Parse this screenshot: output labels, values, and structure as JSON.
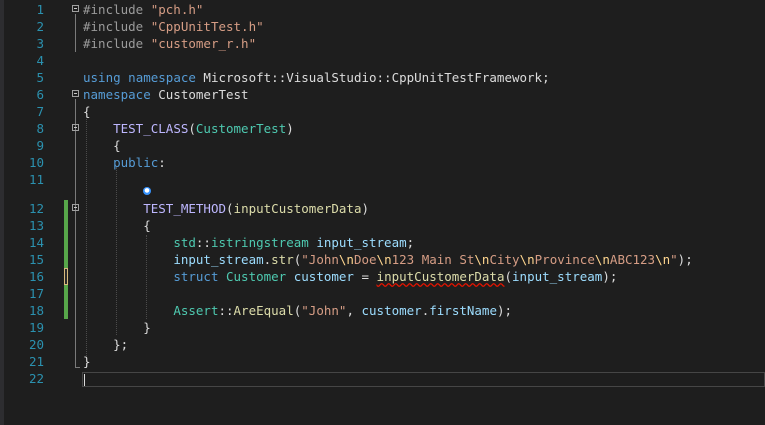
{
  "editor": {
    "language": "C++",
    "hint_icon": "info-icon",
    "colors": {
      "background": "#1e1e1e",
      "line_number": "#2b91af",
      "keyword": "#569cd6",
      "string": "#d69d85",
      "type": "#4ec9b0",
      "function": "#dcdcaa",
      "variable": "#9cdcfe",
      "macro": "#beb7ff",
      "change_marker": "#57a64a",
      "error_squiggle": "#e51400"
    },
    "lines": [
      {
        "n": "1",
        "t": [
          [
            "pp",
            "#include "
          ],
          [
            "str",
            "\"pch.h\""
          ]
        ]
      },
      {
        "n": "2",
        "t": [
          [
            "pp",
            "#include "
          ],
          [
            "str",
            "\"CppUnitTest.h\""
          ]
        ]
      },
      {
        "n": "3",
        "t": [
          [
            "pp",
            "#include "
          ],
          [
            "str",
            "\"customer_r.h\""
          ]
        ]
      },
      {
        "n": "4",
        "t": []
      },
      {
        "n": "5",
        "t": [
          [
            "kw",
            "using"
          ],
          [
            "",
            " "
          ],
          [
            "kw",
            "namespace"
          ],
          [
            "",
            " Microsoft::VisualStudio::CppUnitTestFramework;"
          ]
        ]
      },
      {
        "n": "6",
        "t": [
          [
            "kw",
            "namespace"
          ],
          [
            "",
            " CustomerTest"
          ]
        ]
      },
      {
        "n": "7",
        "t": [
          [
            "",
            "{"
          ]
        ]
      },
      {
        "n": "8",
        "t": [
          [
            "",
            "    "
          ],
          [
            "macro",
            "TEST_CLASS"
          ],
          [
            "",
            "("
          ],
          [
            "type",
            "CustomerTest"
          ],
          [
            "",
            ")"
          ]
        ]
      },
      {
        "n": "9",
        "t": [
          [
            "",
            "    {"
          ]
        ]
      },
      {
        "n": "10",
        "t": [
          [
            "",
            "    "
          ],
          [
            "kw",
            "public"
          ],
          [
            "",
            ":"
          ]
        ]
      },
      {
        "n": "11",
        "t": []
      },
      {
        "n": "12",
        "t": [
          [
            "",
            "        "
          ],
          [
            "macro",
            "TEST_METHOD"
          ],
          [
            "",
            "("
          ],
          [
            "fn",
            "inputCustomerData"
          ],
          [
            "",
            ")"
          ]
        ]
      },
      {
        "n": "13",
        "t": [
          [
            "",
            "        {"
          ]
        ]
      },
      {
        "n": "14",
        "t": [
          [
            "",
            "            "
          ],
          [
            "type",
            "std"
          ],
          [
            "",
            "::"
          ],
          [
            "type",
            "istringstream"
          ],
          [
            "",
            " "
          ],
          [
            "var",
            "input_stream"
          ],
          [
            "",
            ";"
          ]
        ]
      },
      {
        "n": "15",
        "t": [
          [
            "",
            "            "
          ],
          [
            "var",
            "input_stream"
          ],
          [
            "",
            "."
          ],
          [
            "fn",
            "str"
          ],
          [
            "",
            "("
          ],
          [
            "str",
            "\"John"
          ],
          [
            "esc",
            "\\n"
          ],
          [
            "str",
            "Doe"
          ],
          [
            "esc",
            "\\n"
          ],
          [
            "str",
            "123 Main St"
          ],
          [
            "esc",
            "\\n"
          ],
          [
            "str",
            "City"
          ],
          [
            "esc",
            "\\n"
          ],
          [
            "str",
            "Province"
          ],
          [
            "esc",
            "\\n"
          ],
          [
            "str",
            "ABC123"
          ],
          [
            "esc",
            "\\n"
          ],
          [
            "str",
            "\""
          ],
          [
            "",
            ");"
          ]
        ]
      },
      {
        "n": "16",
        "t": [
          [
            "",
            "            "
          ],
          [
            "kw",
            "struct"
          ],
          [
            "",
            " "
          ],
          [
            "type",
            "Customer"
          ],
          [
            "",
            " "
          ],
          [
            "var",
            "customer"
          ],
          [
            "",
            " = "
          ],
          [
            "fn sq",
            "inputCustomerData"
          ],
          [
            "",
            "("
          ],
          [
            "var",
            "input_stream"
          ],
          [
            "",
            ");"
          ]
        ]
      },
      {
        "n": "17",
        "t": []
      },
      {
        "n": "18",
        "t": [
          [
            "",
            "            "
          ],
          [
            "type",
            "Assert"
          ],
          [
            "",
            "::"
          ],
          [
            "fn",
            "AreEqual"
          ],
          [
            "",
            "("
          ],
          [
            "str",
            "\"John\""
          ],
          [
            "",
            ", "
          ],
          [
            "var",
            "customer"
          ],
          [
            "",
            "."
          ],
          [
            "var",
            "firstName"
          ],
          [
            "",
            ");"
          ]
        ]
      },
      {
        "n": "19",
        "t": [
          [
            "",
            "        }"
          ]
        ]
      },
      {
        "n": "20",
        "t": [
          [
            "",
            "    };"
          ]
        ]
      },
      {
        "n": "21",
        "t": [
          [
            "",
            "}"
          ]
        ]
      },
      {
        "n": "22",
        "t": []
      }
    ]
  }
}
